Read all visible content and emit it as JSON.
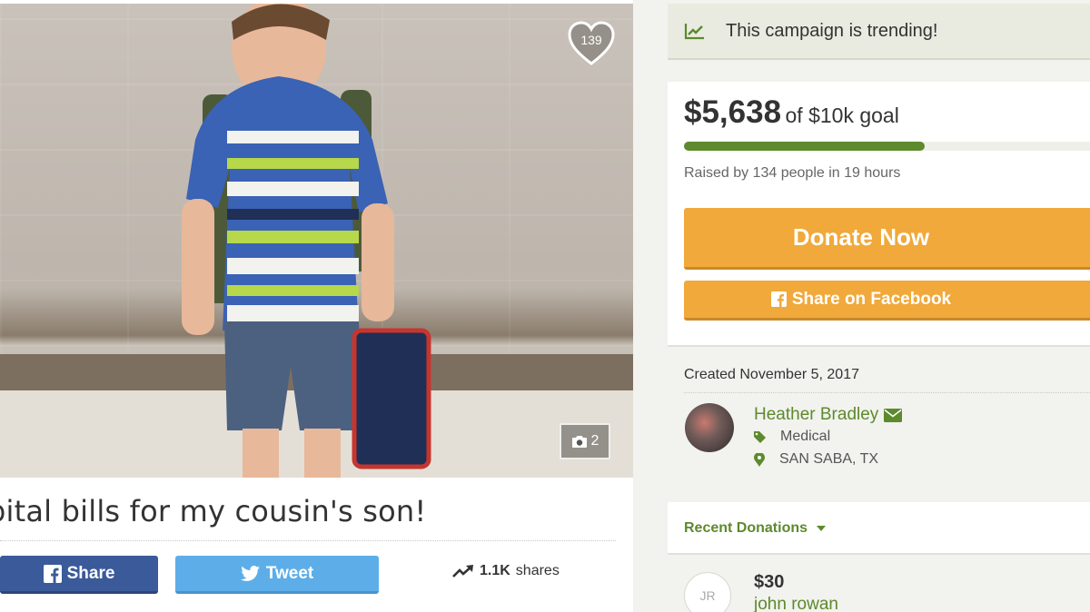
{
  "photo": {
    "heart_count": "139",
    "photo_count": "2"
  },
  "campaign": {
    "title_visible": "pital bills for my cousin's son!"
  },
  "share_bar": {
    "facebook_label": "Share",
    "twitter_label": "Tweet",
    "shares_count": "1.1K",
    "shares_suffix": "shares"
  },
  "trending": {
    "text": "This campaign is trending!"
  },
  "funding": {
    "amount": "$5,638",
    "goal_text": "of $10k goal",
    "progress_fraction": 0.5638,
    "raised_by": "Raised by 134 people in 19 hours",
    "donate_label": "Donate Now",
    "share_facebook_label": "Share on Facebook"
  },
  "organizer": {
    "created": "Created November 5, 2017",
    "name": "Heather Bradley",
    "category": "Medical",
    "location": "SAN SABA, TX"
  },
  "recent": {
    "label": "Recent Donations",
    "donations": [
      {
        "initials": "JR",
        "amount": "$30",
        "name": "john rowan"
      }
    ]
  },
  "colors": {
    "accent_green": "#5c8a2c",
    "donate_orange": "#f0a93a",
    "facebook_blue": "#3b5a9a",
    "twitter_blue": "#5daee8"
  }
}
